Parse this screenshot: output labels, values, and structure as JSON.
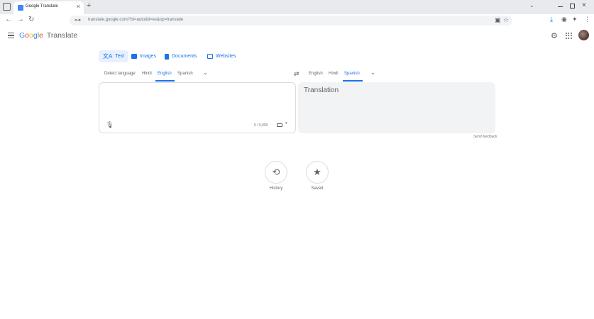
{
  "browser": {
    "tab_title": "Google Translate",
    "tab_close": "×",
    "new_tab": "+",
    "window_chevron": "⌄",
    "window_close": "×",
    "back": "←",
    "forward": "→",
    "reload": "↻",
    "url": "translate.google.com/?sl=auto&tl=es&op=translate",
    "site_info_icon": "⊶",
    "extensions_icon": "▣",
    "bookmark_icon": "☆",
    "download_icon": "⤓",
    "profile_icon": "◉",
    "extension2_icon": "✦",
    "menu_icon": "⋮"
  },
  "app": {
    "logo_letters": [
      "G",
      "o",
      "o",
      "g",
      "l",
      "e"
    ],
    "product": "Translate",
    "settings_icon": "⚙"
  },
  "modes": [
    {
      "label": "Text",
      "icon": "text-icon",
      "active": true
    },
    {
      "label": "Images",
      "icon": "image-icon",
      "active": false
    },
    {
      "label": "Documents",
      "icon": "document-icon",
      "active": false
    },
    {
      "label": "Websites",
      "icon": "website-icon",
      "active": false
    }
  ],
  "source_langs": {
    "items": [
      "Detect language",
      "Hindi",
      "English",
      "Spanish"
    ],
    "active": "English",
    "chevron": "⌄"
  },
  "swap_icon": "⇄",
  "target_langs": {
    "items": [
      "English",
      "Hindi",
      "Spanish"
    ],
    "active": "Spanish",
    "chevron": "⌄"
  },
  "source_panel": {
    "text": "",
    "mic_icon": "🎙",
    "counter": "0 / 5,000",
    "keyboard_caret": "▾"
  },
  "target_panel": {
    "placeholder": "Translation"
  },
  "feedback": "Send feedback",
  "shortcuts": [
    {
      "label": "History",
      "icon": "history-icon",
      "glyph": "⟲"
    },
    {
      "label": "Saved",
      "icon": "star-icon",
      "glyph": "★"
    }
  ],
  "colors": {
    "accent": "#1a73e8",
    "accent_bg": "#e8f0fe",
    "panel_bg": "#f1f3f4"
  }
}
